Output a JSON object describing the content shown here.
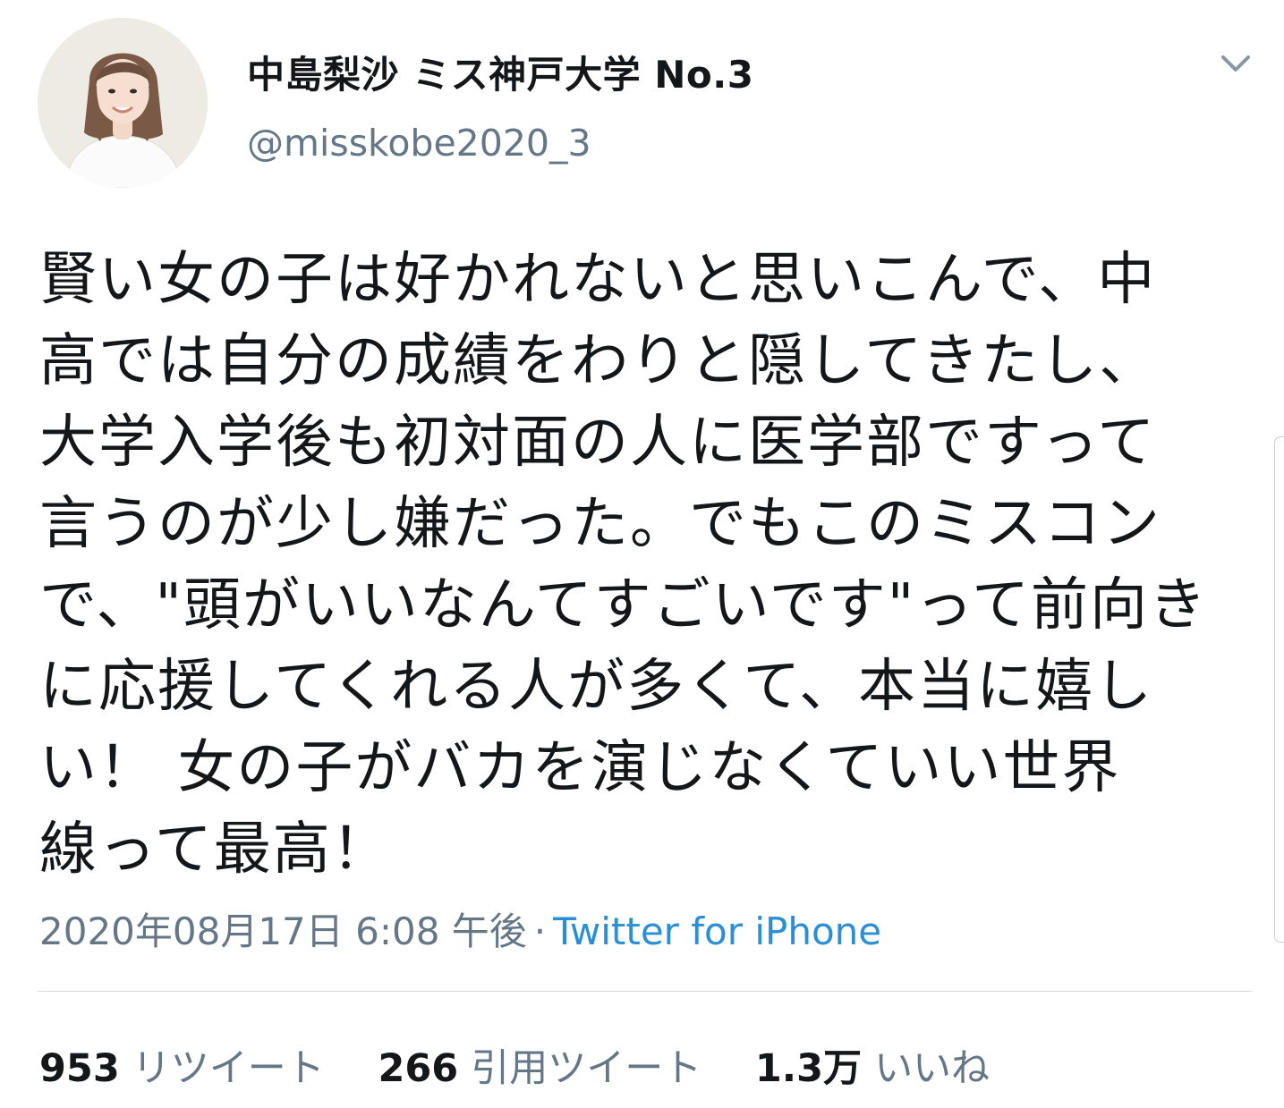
{
  "tweet": {
    "display_name": "中島梨沙 ミス神戸大学 No.3",
    "handle": "@misskobe2020_3",
    "text_lines": [
      "賢い女の子は好かれないと思いこんで、中",
      "高では自分の成績をわりと隠してきたし、",
      "大学入学後も初対面の人に医学部ですって",
      "言うのが少し嫌だった。でもこのミスコン",
      "で、\"頭がいいなんてすごいです\"って前向き",
      "に応援してくれる人が多くて、本当に嬉し",
      "い！ 女の子がバカを演じなくていい世界",
      "線って最高！"
    ],
    "timestamp": "2020年08月17日 6:08 午後",
    "separator": "·",
    "source": "Twitter for iPhone"
  },
  "stats": {
    "retweets_count": "953",
    "retweets_label": "リツイート",
    "quotes_count": "266",
    "quotes_label": "引用ツイート",
    "likes_count": "1.3万",
    "likes_label": "いいね"
  },
  "icons": {
    "menu": "chevron-down-icon"
  },
  "colors": {
    "text": "#14171a",
    "secondary": "#657786",
    "link": "#2b8fd6",
    "divider": "#d5dde3"
  }
}
